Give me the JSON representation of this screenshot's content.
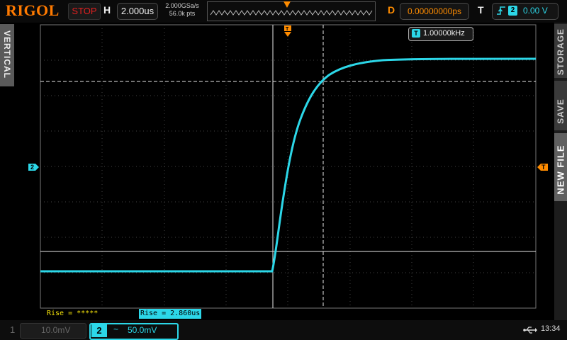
{
  "header": {
    "brand": "RIGOL",
    "run_status": "STOP",
    "horizontal_label": "H",
    "timebase": "2.000us",
    "sample_rate": "2.000GSa/s",
    "memory_points": "56.0k pts",
    "delay_label": "D",
    "delay_value": "0.00000000ps",
    "trigger_label": "T",
    "trigger_source": "2",
    "trigger_level": "0.00 V"
  },
  "side_tabs": {
    "left": "VERTICAL",
    "right_storage": "STORAGE",
    "right_save": "SAVE",
    "right_new_file": "NEW FILE"
  },
  "display": {
    "frequency_badge": "T",
    "frequency": "1.00000kHz",
    "channel_marker": "2",
    "trigger_marker": "T",
    "top_trigger_marker": "T"
  },
  "measurements": {
    "item1": "Rise = *****",
    "item2": "Rise = 2.860us"
  },
  "footer": {
    "ch1_number": "1",
    "ch1_scale": "10.0mV",
    "ch2_number": "2",
    "ch2_coupling": "~",
    "ch2_scale": "50.0mV",
    "clock": "13:34"
  },
  "colors": {
    "ch2": "#2cd7e8",
    "trigger": "#ff8c00",
    "stop": "#e02020",
    "measure": "#f4e20a"
  }
}
